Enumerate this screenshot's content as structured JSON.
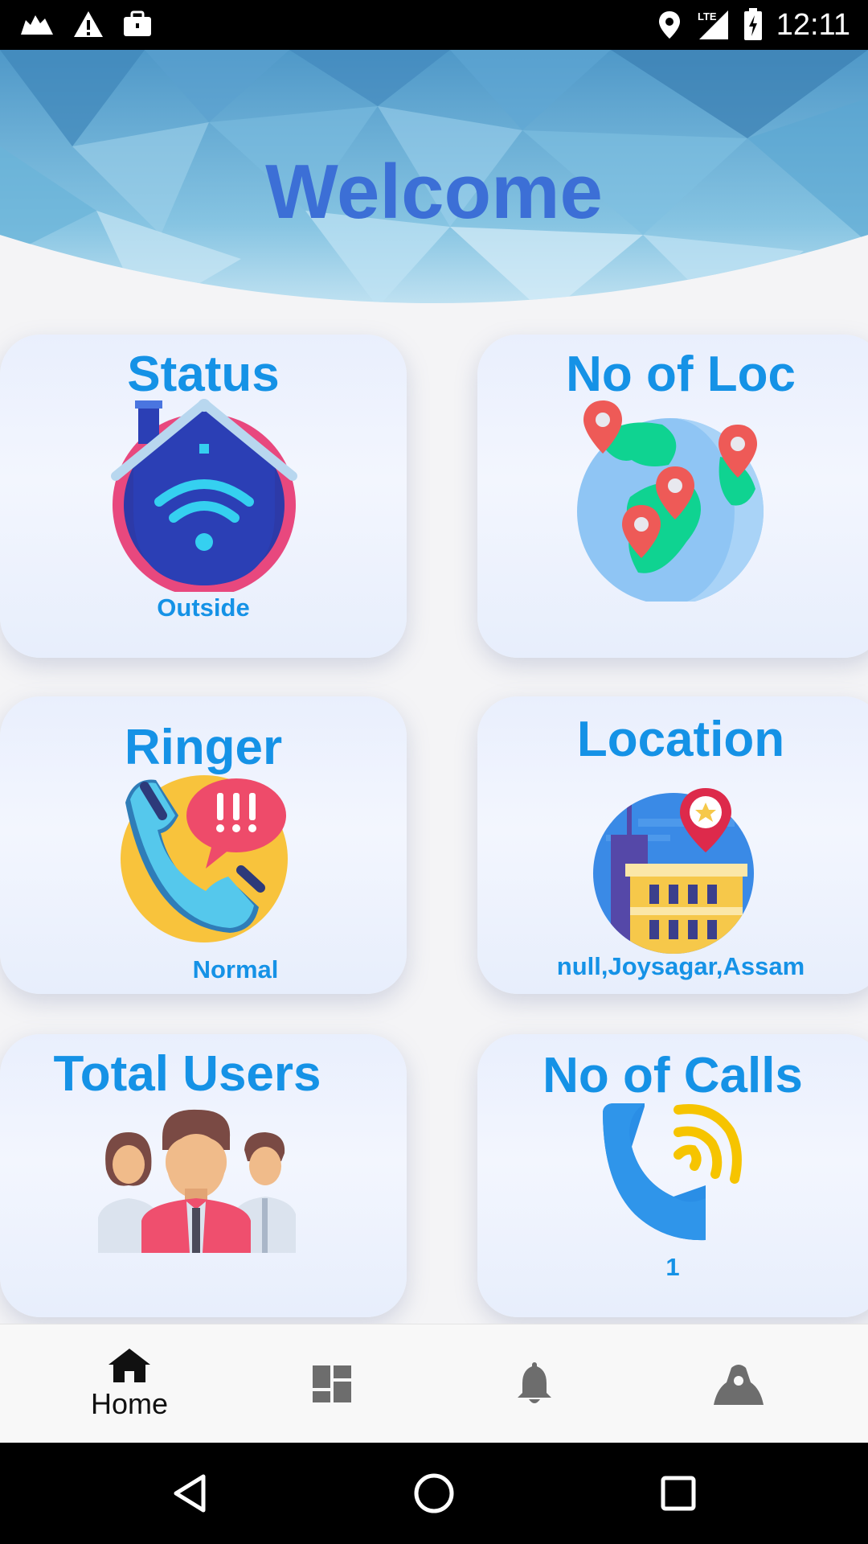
{
  "status_bar": {
    "time": "12:11",
    "network": "LTE",
    "icons": [
      "cloud-icon",
      "warning-icon",
      "briefcase-icon",
      "location-pin-icon",
      "signal-icon",
      "battery-charging-icon"
    ]
  },
  "header": {
    "title": "Welcome"
  },
  "cards": {
    "status": {
      "title": "Status",
      "value": "Outside",
      "icon": "smart-home-wifi-icon"
    },
    "locations": {
      "title": "No of Loc",
      "value": "",
      "icon": "globe-pins-icon"
    },
    "ringer": {
      "title": "Ringer",
      "value": "Normal",
      "icon": "phone-alert-icon"
    },
    "location": {
      "title": "Location",
      "value": "null,Joysagar,Assam",
      "icon": "city-pin-icon"
    },
    "users": {
      "title": "Total Users",
      "value": "",
      "icon": "users-group-icon"
    },
    "calls": {
      "title": "No of Calls",
      "value": "1",
      "icon": "phone-call-icon"
    }
  },
  "bottom_nav": {
    "items": [
      {
        "label": "Home",
        "icon": "home-icon",
        "active": true
      },
      {
        "label": "",
        "icon": "dashboard-icon",
        "active": false
      },
      {
        "label": "",
        "icon": "bell-icon",
        "active": false
      },
      {
        "label": "",
        "icon": "spy-icon",
        "active": false
      }
    ]
  },
  "system_nav": [
    "back-icon",
    "home-circle-icon",
    "recents-icon"
  ],
  "colors": {
    "accent": "#1592e6",
    "title": "#3c6fd6",
    "status_bar": "#000000"
  }
}
